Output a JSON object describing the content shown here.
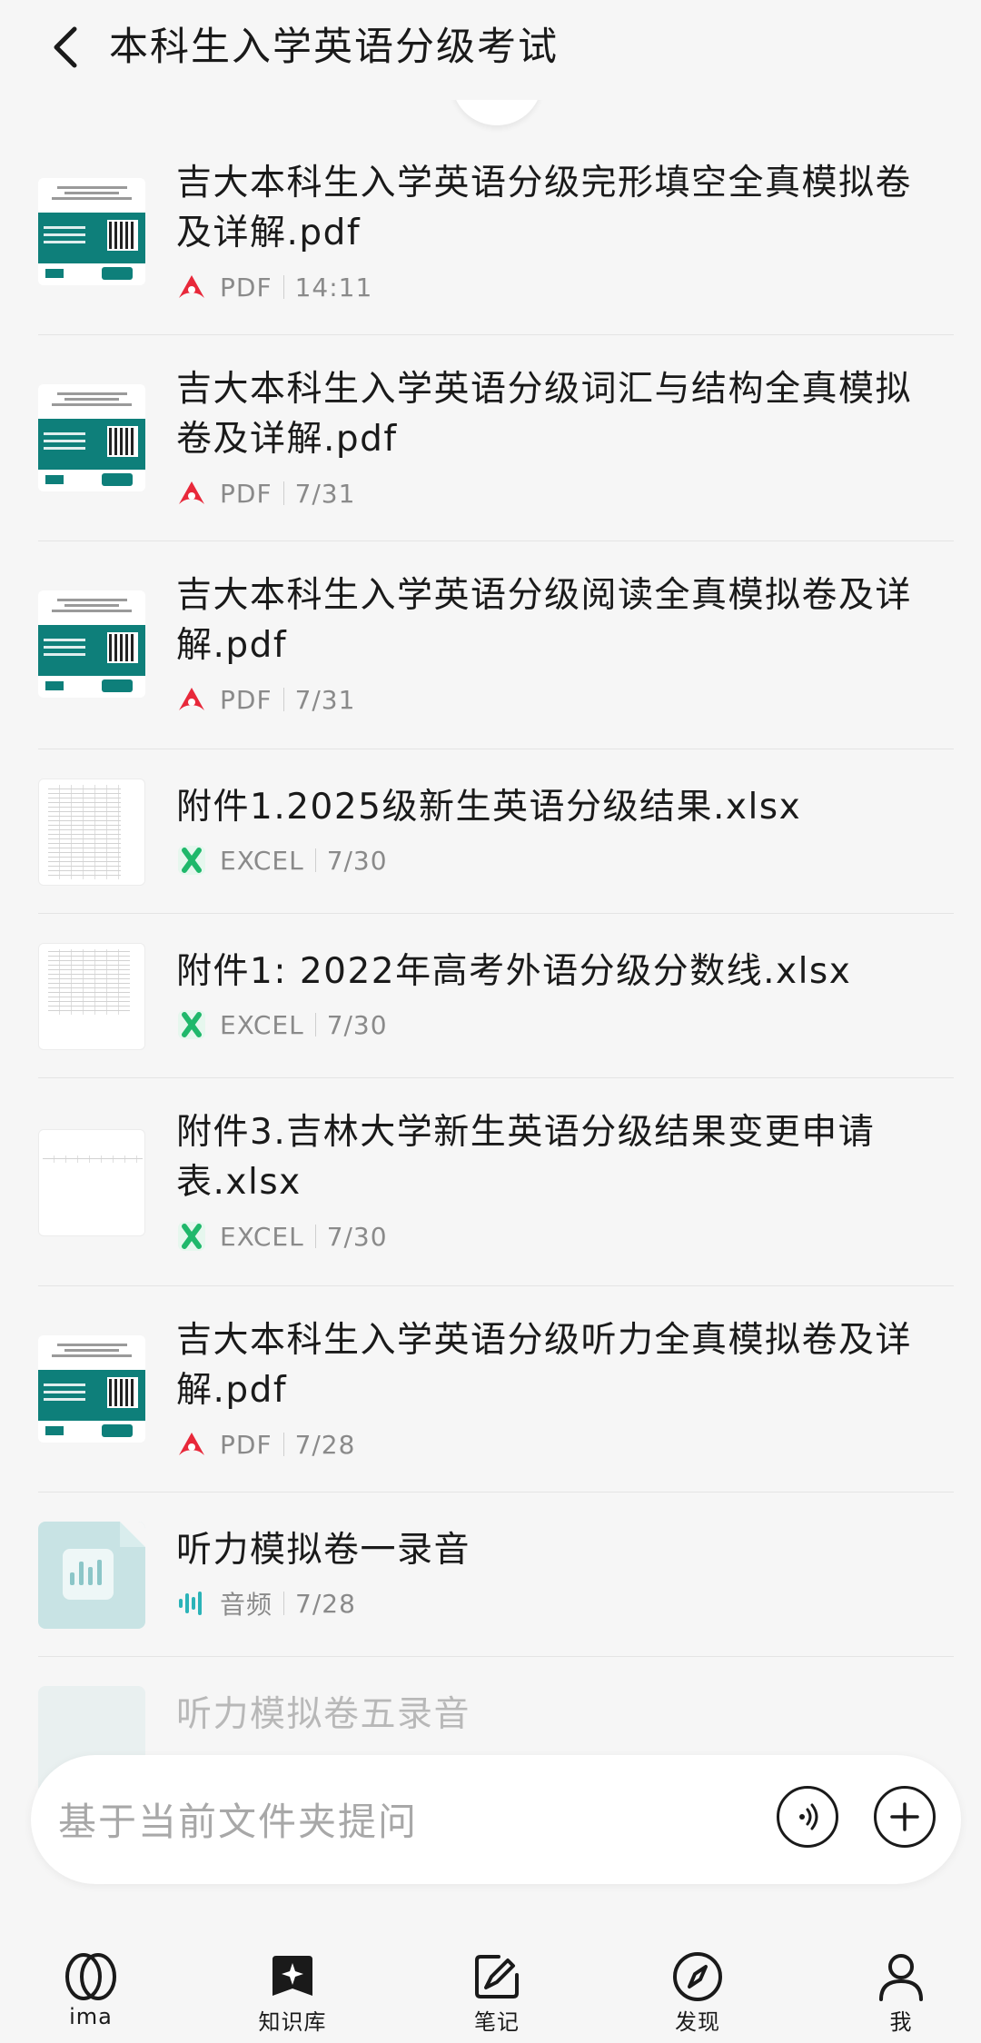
{
  "header": {
    "title": "本科生入学英语分级考试"
  },
  "files": [
    {
      "title": "吉大本科生入学英语分级完形填空全真模拟卷及详解.pdf",
      "type": "PDF",
      "date": "14:11"
    },
    {
      "title": "吉大本科生入学英语分级词汇与结构全真模拟卷及详解.pdf",
      "type": "PDF",
      "date": "7/31"
    },
    {
      "title": "吉大本科生入学英语分级阅读全真模拟卷及详解.pdf",
      "type": "PDF",
      "date": "7/31"
    },
    {
      "title": "附件1.2025级新生英语分级结果.xlsx",
      "type": "EXCEL",
      "date": "7/30"
    },
    {
      "title": "附件1: 2022年高考外语分级分数线.xlsx",
      "type": "EXCEL",
      "date": "7/30"
    },
    {
      "title": "附件3.吉林大学新生英语分级结果变更申请表.xlsx",
      "type": "EXCEL",
      "date": "7/30"
    },
    {
      "title": "吉大本科生入学英语分级听力全真模拟卷及详解.pdf",
      "type": "PDF",
      "date": "7/28"
    },
    {
      "title": "听力模拟卷一录音",
      "type": "音频",
      "date": "7/28"
    },
    {
      "title": "听力模拟卷五录音"
    }
  ],
  "ask": {
    "placeholder": "基于当前文件夹提问"
  },
  "nav": {
    "ima": "ima",
    "library": "知识库",
    "notes": "笔记",
    "discover": "发现",
    "me": "我"
  },
  "colors": {
    "pdf": "#e8283a",
    "excel": "#1fb86b",
    "audio": "#2bb3b8"
  }
}
